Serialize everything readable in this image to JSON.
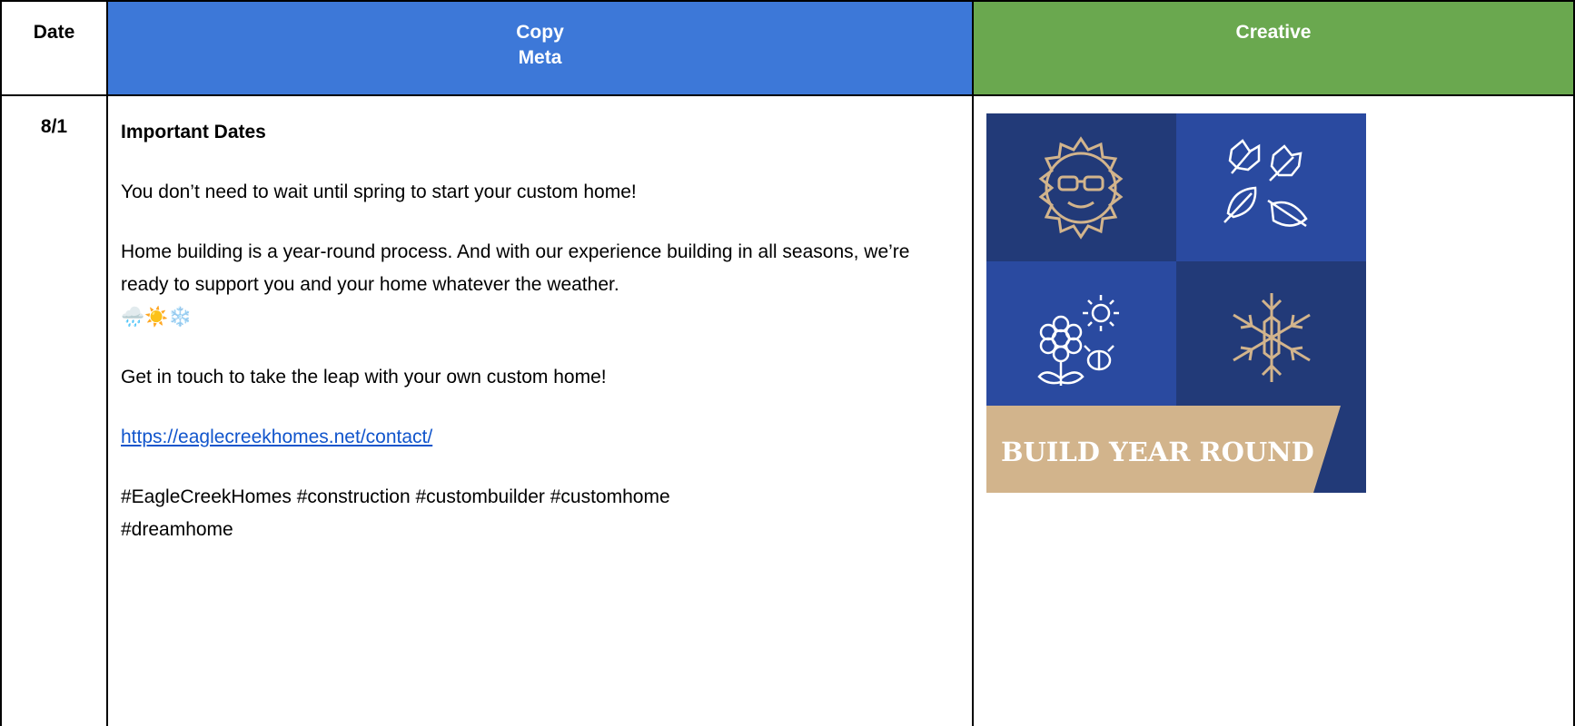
{
  "header": {
    "date_label": "Date",
    "copy_label_line1": "Copy",
    "copy_label_line2": "Meta",
    "creative_label": "Creative"
  },
  "row": {
    "date": "8/1",
    "title": "Important Dates",
    "paragraph1": "You don’t need to wait until spring to start your custom home!",
    "paragraph2": "Home building is a year-round process. And with our experience building in all seasons, we’re ready to support you and your home whatever the weather.",
    "emojis": "🌧️☀️❄️",
    "paragraph3": "Get in touch to take the leap with your own custom home!",
    "link": "https://eaglecreekhomes.net/contact/",
    "hashtags_line1": "#EagleCreekHomes #construction #custombuilder #customhome",
    "hashtags_line2": "#dreamhome"
  },
  "creative": {
    "banner_text": "BUILD YEAR ROUND",
    "icons": [
      "sun-with-sunglasses-icon",
      "leaves-icon",
      "flower-sun-bug-icon",
      "snowflake-icon"
    ],
    "colors": {
      "dark_navy": "#223a78",
      "mid_blue": "#2a4aa0",
      "tan": "#d2b48c",
      "header_blue": "#3d78d8",
      "header_green": "#6aa84f",
      "link_blue": "#1155cc"
    }
  }
}
